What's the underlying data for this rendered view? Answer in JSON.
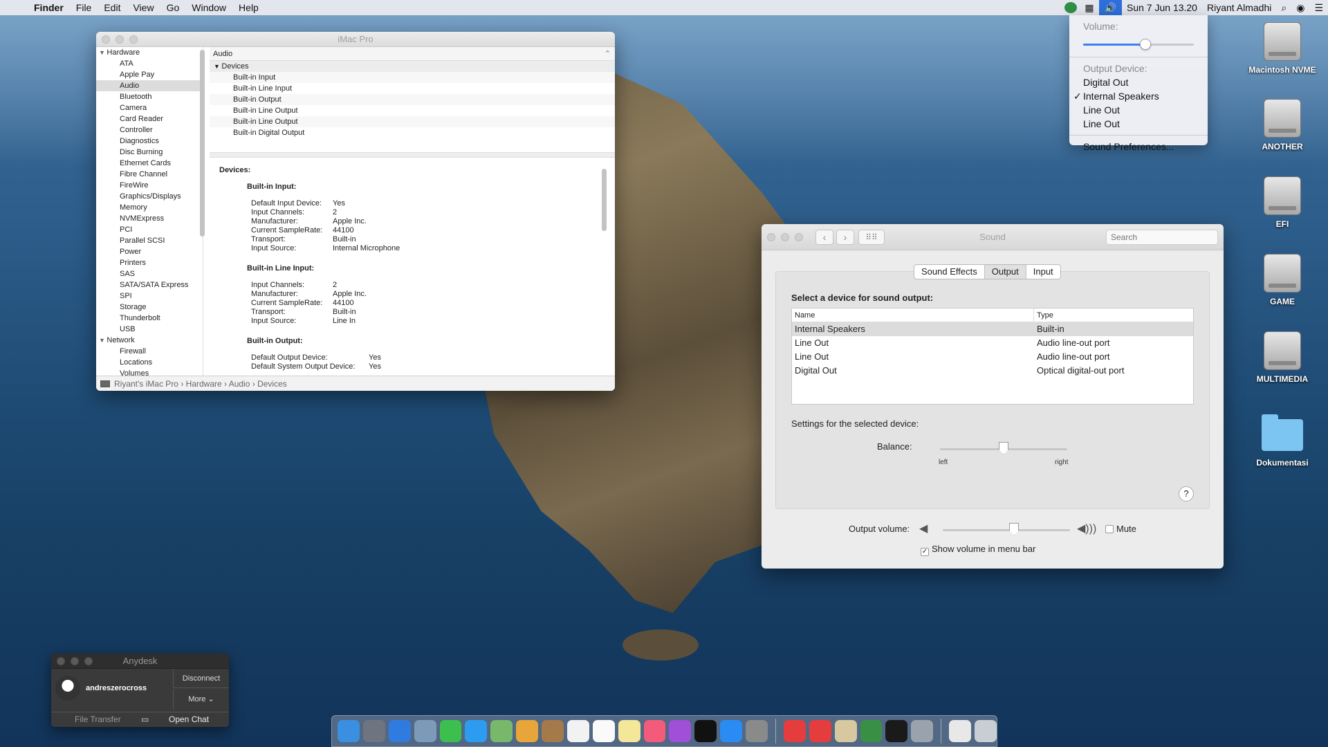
{
  "menubar": {
    "app": "Finder",
    "menus": [
      "File",
      "Edit",
      "View",
      "Go",
      "Window",
      "Help"
    ],
    "clock": "Sun 7 Jun  13.20",
    "user": "Riyant Almadhi"
  },
  "volume_menu": {
    "volume_label": "Volume:",
    "volume_level": 0.56,
    "output_label": "Output Device:",
    "devices": [
      "Digital Out",
      "Internal Speakers",
      "Line Out",
      "Line Out"
    ],
    "selected": "Internal Speakers",
    "prefs": "Sound Preferences..."
  },
  "desktop": {
    "icons": [
      "Macintosh NVME",
      "ANOTHER",
      "EFI",
      "GAME",
      "MULTIMEDIA",
      "Dokumentasi"
    ]
  },
  "sysinfo": {
    "title": "iMac Pro",
    "sidebar_hardware": "Hardware",
    "hardware_items": [
      "ATA",
      "Apple Pay",
      "Audio",
      "Bluetooth",
      "Camera",
      "Card Reader",
      "Controller",
      "Diagnostics",
      "Disc Burning",
      "Ethernet Cards",
      "Fibre Channel",
      "FireWire",
      "Graphics/Displays",
      "Memory",
      "NVMExpress",
      "PCI",
      "Parallel SCSI",
      "Power",
      "Printers",
      "SAS",
      "SATA/SATA Express",
      "SPI",
      "Storage",
      "Thunderbolt",
      "USB"
    ],
    "selected_item": "Audio",
    "sidebar_network": "Network",
    "network_items": [
      "Firewall",
      "Locations",
      "Volumes"
    ],
    "section": "Audio",
    "group": "Devices",
    "device_list": [
      "Built-in Input",
      "Built-in Line Input",
      "Built-in Output",
      "Built-in Line Output",
      "Built-in Line Output",
      "Built-in Digital Output"
    ],
    "detail_heading": "Devices:",
    "input_title": "Built-in Input:",
    "input_rows": [
      {
        "k": "Default Input Device:",
        "v": "Yes"
      },
      {
        "k": "Input Channels:",
        "v": "2"
      },
      {
        "k": "Manufacturer:",
        "v": "Apple Inc."
      },
      {
        "k": "Current SampleRate:",
        "v": "44100"
      },
      {
        "k": "Transport:",
        "v": "Built-in"
      },
      {
        "k": "Input Source:",
        "v": "Internal Microphone"
      }
    ],
    "line_input_title": "Built-in Line Input:",
    "line_input_rows": [
      {
        "k": "Input Channels:",
        "v": "2"
      },
      {
        "k": "Manufacturer:",
        "v": "Apple Inc."
      },
      {
        "k": "Current SampleRate:",
        "v": "44100"
      },
      {
        "k": "Transport:",
        "v": "Built-in"
      },
      {
        "k": "Input Source:",
        "v": "Line In"
      }
    ],
    "output_title": "Built-in Output:",
    "output_rows": [
      {
        "k": "Default Output Device:",
        "v": "Yes"
      },
      {
        "k": "Default System Output Device:",
        "v": "Yes"
      }
    ],
    "path": [
      "Riyant's iMac Pro",
      "Hardware",
      "Audio",
      "Devices"
    ]
  },
  "sound": {
    "title": "Sound",
    "search_placeholder": "Search",
    "tabs": [
      "Sound Effects",
      "Output",
      "Input"
    ],
    "active_tab": "Output",
    "select_label": "Select a device for sound output:",
    "col_name": "Name",
    "col_type": "Type",
    "rows": [
      {
        "name": "Internal Speakers",
        "type": "Built-in"
      },
      {
        "name": "Line Out",
        "type": "Audio line-out port"
      },
      {
        "name": "Line Out",
        "type": "Audio line-out port"
      },
      {
        "name": "Digital Out",
        "type": "Optical digital-out port"
      }
    ],
    "settings_label": "Settings for the selected device:",
    "balance_label": "Balance:",
    "balance_value": 0.5,
    "left_label": "left",
    "right_label": "right",
    "help": "?",
    "output_volume_label": "Output volume:",
    "output_volume": 0.56,
    "mute_label": "Mute",
    "show_volume_label": "Show volume in menu bar"
  },
  "anydesk": {
    "title": "Anydesk",
    "user": "andreszerocross",
    "disconnect": "Disconnect",
    "more": "More",
    "file_transfer": "File Transfer",
    "open_chat": "Open Chat"
  }
}
